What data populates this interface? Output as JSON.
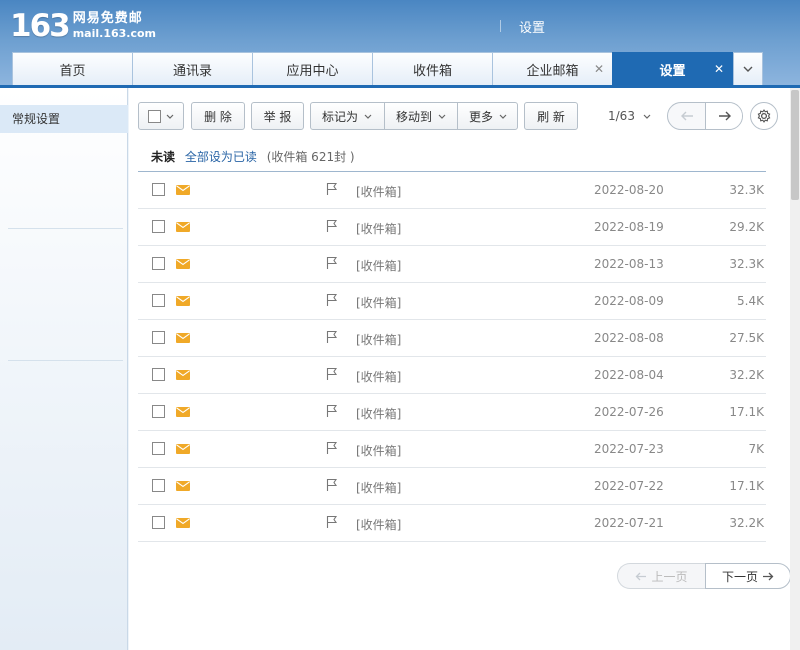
{
  "header": {
    "logo_num": "163",
    "logo_cn": "网易免费邮",
    "logo_en": "mail.163.com",
    "title": "设置"
  },
  "tabs": [
    {
      "label": "首页",
      "closable": false,
      "active": false
    },
    {
      "label": "通讯录",
      "closable": false,
      "active": false
    },
    {
      "label": "应用中心",
      "closable": false,
      "active": false
    },
    {
      "label": "收件箱",
      "closable": false,
      "active": false
    },
    {
      "label": "企业邮箱",
      "closable": true,
      "active": false
    },
    {
      "label": "设置",
      "closable": true,
      "active": true
    }
  ],
  "sidebar": {
    "items": [
      {
        "label": "常规设置"
      }
    ]
  },
  "toolbar": {
    "delete": "删 除",
    "report": "举 报",
    "mark_as": "标记为",
    "move_to": "移动到",
    "more": "更多",
    "refresh": "刷 新"
  },
  "pager": {
    "page_text": "1/63"
  },
  "summary": {
    "unread": "未读",
    "mark_all": "全部设为已读",
    "count": "(收件箱 621封 )"
  },
  "emails": [
    {
      "folder": "[收件箱]",
      "date": "2022-08-20",
      "size": "32.3K"
    },
    {
      "folder": "[收件箱]",
      "date": "2022-08-19",
      "size": "29.2K"
    },
    {
      "folder": "[收件箱]",
      "date": "2022-08-13",
      "size": "32.3K"
    },
    {
      "folder": "[收件箱]",
      "date": "2022-08-09",
      "size": "5.4K"
    },
    {
      "folder": "[收件箱]",
      "date": "2022-08-08",
      "size": "27.5K"
    },
    {
      "folder": "[收件箱]",
      "date": "2022-08-04",
      "size": "32.2K"
    },
    {
      "folder": "[收件箱]",
      "date": "2022-07-26",
      "size": "17.1K"
    },
    {
      "folder": "[收件箱]",
      "date": "2022-07-23",
      "size": "7K"
    },
    {
      "folder": "[收件箱]",
      "date": "2022-07-22",
      "size": "17.1K"
    },
    {
      "folder": "[收件箱]",
      "date": "2022-07-21",
      "size": "32.2K"
    }
  ],
  "bottom_pager": {
    "prev": "上一页",
    "next": "下一页"
  },
  "colors": {
    "accent": "#1f6ab3",
    "envelope": "#f0a928",
    "link": "#2a65a6"
  },
  "icons": [
    "close-icon",
    "chevron-down-icon",
    "arrow-left-icon",
    "arrow-right-icon",
    "gear-icon",
    "envelope-icon",
    "flag-icon"
  ]
}
